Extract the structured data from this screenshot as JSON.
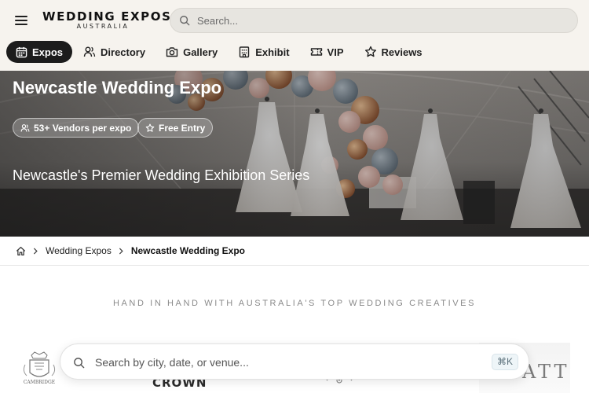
{
  "header": {
    "logo": {
      "main": "WEDDING EXPOS",
      "sub": "AUSTRALIA"
    },
    "search": {
      "placeholder": "Search..."
    },
    "nav": [
      {
        "label": "Expos",
        "icon": "calendar-icon",
        "active": true
      },
      {
        "label": "Directory",
        "icon": "users-icon",
        "active": false
      },
      {
        "label": "Gallery",
        "icon": "camera-icon",
        "active": false
      },
      {
        "label": "Exhibit",
        "icon": "building-icon",
        "active": false
      },
      {
        "label": "VIP",
        "icon": "ticket-icon",
        "active": false
      },
      {
        "label": "Reviews",
        "icon": "star-icon",
        "active": false
      }
    ]
  },
  "hero": {
    "title": "Newcastle Wedding Expo",
    "pills": [
      {
        "label": "53+ Vendors per expo",
        "icon": "users-icon"
      },
      {
        "label": "Free Entry",
        "icon": "star-icon"
      }
    ],
    "subtitle": "Newcastle's Premier Wedding Exhibition Series"
  },
  "breadcrumb": {
    "items": [
      "Wedding Expos",
      "Newcastle Wedding Expo"
    ]
  },
  "partners": {
    "heading": "HAND IN HAND WITH AUSTRALIA'S TOP WEDDING CREATIVES",
    "logos": [
      {
        "name": "CAMBRIDGE"
      },
      {
        "name": "CROWN"
      },
      {
        "name": "ornament"
      },
      {
        "name": "ATT"
      }
    ]
  },
  "floating_search": {
    "placeholder": "Search by city, date, or venue...",
    "shortcut": "⌘K"
  },
  "colors": {
    "header_bg": "#f6f3ee",
    "nav_active_bg": "#1c1c1c",
    "accent_text": "#ffffff"
  }
}
